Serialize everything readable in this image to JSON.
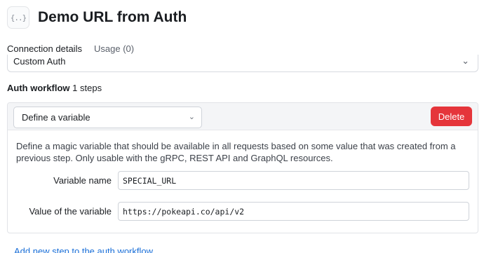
{
  "header": {
    "icon": "curly-braces-icon",
    "icon_glyph": "{..}",
    "title": "Demo URL from Auth"
  },
  "tabs": [
    {
      "label": "Connection details",
      "active": true
    },
    {
      "label": "Usage (0)",
      "active": false
    }
  ],
  "auth_type": {
    "value": "Custom Auth"
  },
  "auth_workflow": {
    "label": "Auth workflow",
    "steps_count": "1 steps"
  },
  "step": {
    "type_value": "Define a variable",
    "delete_label": "Delete",
    "delete_color": "#e5353b",
    "description": "Define a magic variable that should be available in all requests based on some value that was created from a previous step. Only usable with the gRPC, REST API and GraphQL resources.",
    "fields": {
      "variable_name": {
        "label": "Variable name",
        "value": "SPECIAL_URL"
      },
      "variable_value": {
        "label": "Value of the variable",
        "value": "https://pokeapi.co/api/v2"
      }
    }
  },
  "add_step_label": "Add new step to the auth workflow",
  "colors": {
    "link": "#1a6fd8",
    "active_tab": "#1a1d21"
  }
}
